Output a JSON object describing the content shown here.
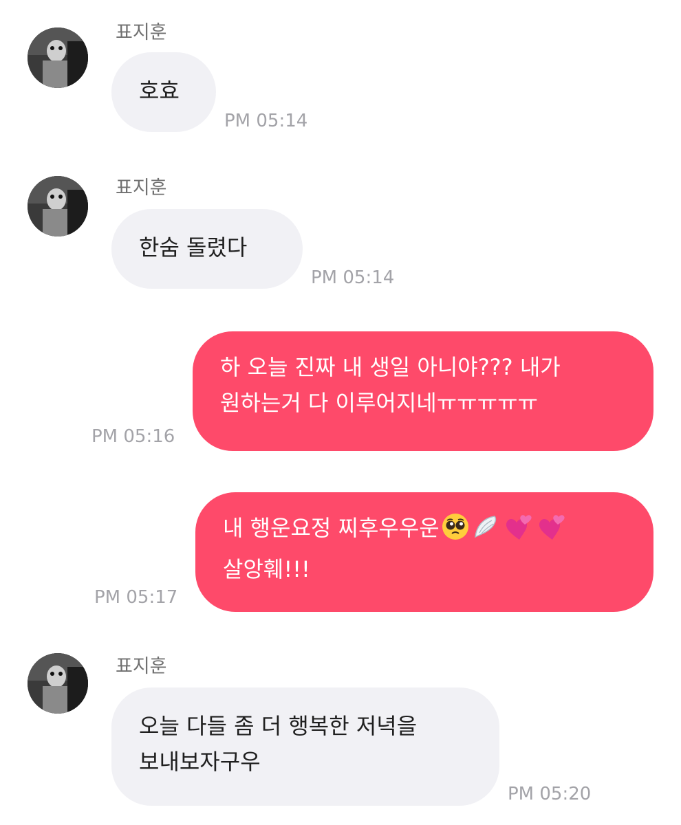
{
  "messages": [
    {
      "sender": "표지훈",
      "lines": [
        "호효"
      ],
      "time": "PM 05:14"
    },
    {
      "sender": "표지훈",
      "lines": [
        "한숨 돌렸다"
      ],
      "time": "PM 05:14"
    },
    {
      "lines": [
        "하 오늘 진짜 내 생일 아니야??? 내가",
        "원하는거 다 이루어지네ㅠㅠㅠㅠㅠ"
      ],
      "time": "PM 05:16"
    },
    {
      "lines": [
        "내 행운요정 찌후우우운",
        "살앙훼!!!"
      ],
      "emojis": [
        "pleading-face-emoji",
        "wing-emoji",
        "two-hearts-emoji",
        "two-hearts-emoji"
      ],
      "time": "PM 05:17"
    },
    {
      "sender": "표지훈",
      "lines": [
        "오늘 다들 좀 더 행복한 저녁을",
        "보내보자구우"
      ],
      "time": "PM 05:20"
    }
  ],
  "colors": {
    "incoming_bubble": "#f1f1f5",
    "outgoing_bubble": "#fe4a6a",
    "timestamp": "#a3a3a8",
    "sender_name": "#707070"
  }
}
